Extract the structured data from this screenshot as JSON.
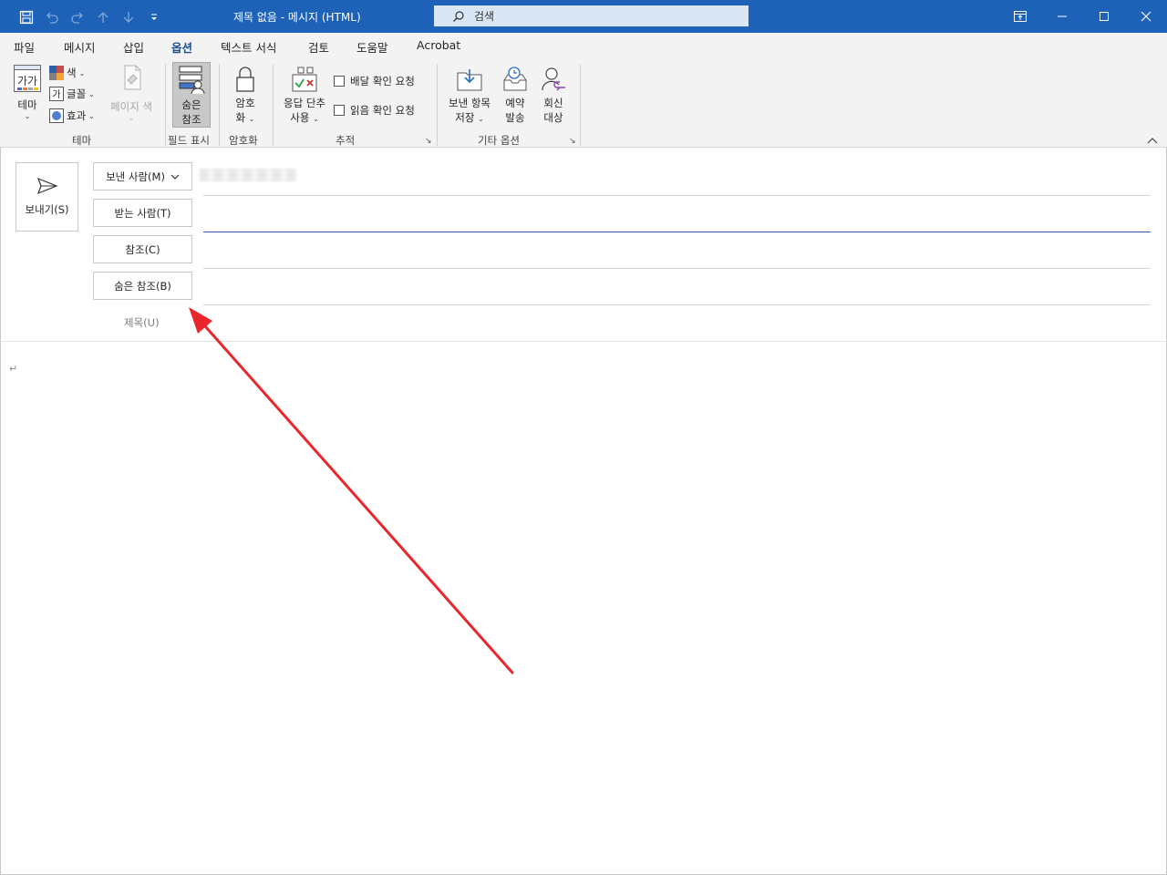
{
  "window": {
    "title": "제목 없음  -  메시지 (HTML)",
    "search_label": "검색"
  },
  "ribbon_tabs": [
    {
      "label": "파일",
      "active": false
    },
    {
      "label": "메시지",
      "active": false
    },
    {
      "label": "삽입",
      "active": false
    },
    {
      "label": "옵션",
      "active": true
    },
    {
      "label": "텍스트 서식",
      "active": false
    },
    {
      "label": "검토",
      "active": false
    },
    {
      "label": "도움말",
      "active": false
    },
    {
      "label": "Acrobat",
      "active": false
    }
  ],
  "ribbon": {
    "theme_group": {
      "label": "테마",
      "theme_btn": "테마",
      "theme_icon_text": "가가",
      "colors": "색",
      "fonts": "글꼴",
      "fonts_icon_text": "가",
      "effects": "효과",
      "page_color_line1": "페이지 색"
    },
    "show_fields_group": {
      "label": "필드 표시",
      "bcc_line1": "숨은",
      "bcc_line2": "참조"
    },
    "encrypt_group": {
      "label": "암호화",
      "encrypt_line1": "암호",
      "encrypt_line2": "화"
    },
    "tracking_group": {
      "label": "추적",
      "voting_line1": "응답 단추",
      "voting_line2": "사용",
      "delivery_receipt": "배달 확인 요청",
      "read_receipt": "읽음 확인 요청"
    },
    "more_options_group": {
      "label": "기타 옵션",
      "save_sent_line1": "보낸 항목",
      "save_sent_line2": "저장",
      "delay_line1": "예약",
      "delay_line2": "발송",
      "reply_to_line1": "회신",
      "reply_to_line2": "대상"
    }
  },
  "compose": {
    "send": "보내기(S)",
    "from": "보낸 사람(M)",
    "to": "받는 사람(T)",
    "cc": "참조(C)",
    "bcc": "숨은 참조(B)",
    "subject": "제목(U)",
    "body_mark": "↵"
  },
  "colors": {
    "title_bar": "#1e62b8",
    "accent": "#1e4e8c",
    "annotation_arrow": "#e8262c"
  }
}
